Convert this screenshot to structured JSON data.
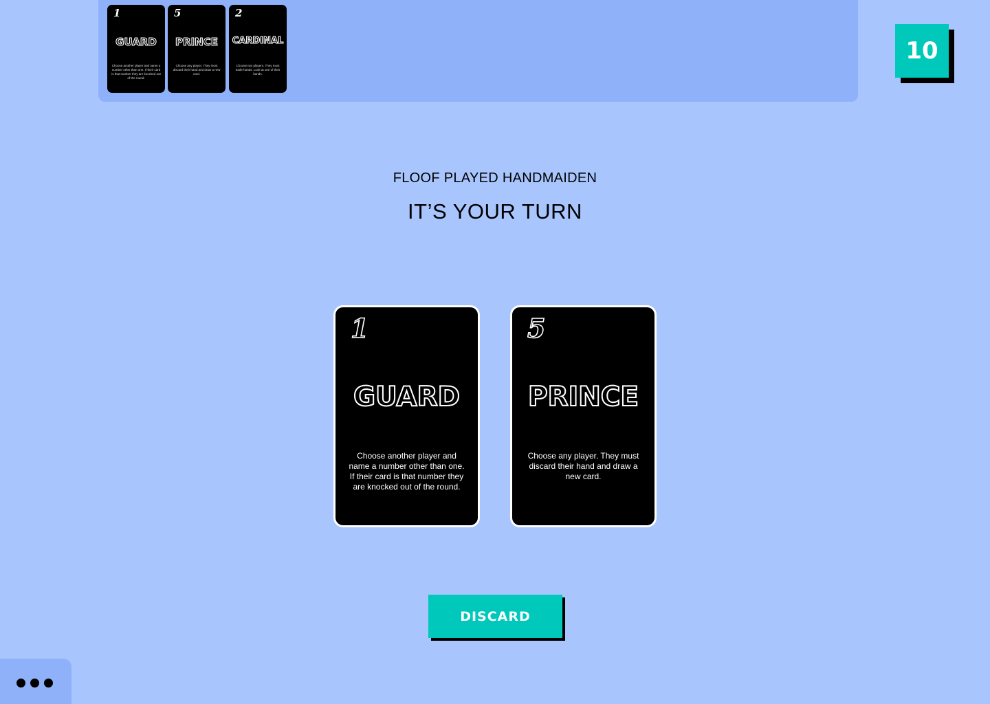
{
  "played_cards": [
    {
      "number": "1",
      "name": "GUARD",
      "description": "Choose another player and name a number other than one. If their card is that number they are knocked out of the round."
    },
    {
      "number": "5",
      "name": "PRINCE",
      "description": "Choose any player. They must discard their hand and draw a new card."
    },
    {
      "number": "2",
      "name": "CARDINAL",
      "description": "Choose two players. They must trade hands. Look at one of their hands."
    }
  ],
  "score": "10",
  "status_message": "FLOOF PLAYED HANDMAIDEN",
  "turn_message": "IT’S YOUR TURN",
  "hand": [
    {
      "number": "1",
      "name": "GUARD",
      "description": "Choose another player and name a number other than one. If their card is that number they are knocked out of the round."
    },
    {
      "number": "5",
      "name": "PRINCE",
      "description": "Choose any player. They must discard their hand and draw a new card."
    }
  ],
  "discard_button_label": "DISCARD",
  "menu_icon": "more-dots-icon",
  "colors": {
    "background": "#a8c5fd",
    "panel": "#8fb1fa",
    "accent": "#00c8bb",
    "card": "#000000"
  }
}
